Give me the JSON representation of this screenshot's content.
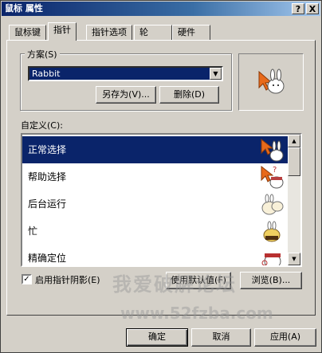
{
  "window": {
    "title": "鼠标 属性"
  },
  "title_buttons": {
    "help": "?",
    "close": "X"
  },
  "tabs": [
    {
      "label": "鼠标键"
    },
    {
      "label": "指针"
    },
    {
      "label": "指针选项"
    },
    {
      "label": "轮"
    },
    {
      "label": "硬件"
    }
  ],
  "scheme": {
    "group_label": "方案(S)",
    "selected": "Rabbit",
    "save_as_label": "另存为(V)...",
    "delete_label": "删除(D)"
  },
  "customize": {
    "label": "自定义(C):",
    "items": [
      {
        "label": "正常选择",
        "icon": "arrow-rabbit-icon"
      },
      {
        "label": "帮助选择",
        "icon": "help-rabbit-icon"
      },
      {
        "label": "后台运行",
        "icon": "working-rabbit-icon"
      },
      {
        "label": "忙",
        "icon": "busy-rabbit-icon"
      },
      {
        "label": "精确定位",
        "icon": "precision-rabbit-icon"
      }
    ]
  },
  "shadow": {
    "label": "启用指针阴影(E)",
    "checked": true,
    "mark": "✓"
  },
  "use_default_label": "使用默认值(F)",
  "browse_label": "浏览(B)...",
  "footer": {
    "ok_label": "确定",
    "cancel_label": "取消",
    "apply_label": "应用(A)"
  },
  "watermark": {
    "text": "我爱破解论坛",
    "url": "www.52fzba.com"
  },
  "colors": {
    "selection": "#0a246a",
    "cursor": "#e86a1a",
    "dialog": "#d4d0c8"
  }
}
